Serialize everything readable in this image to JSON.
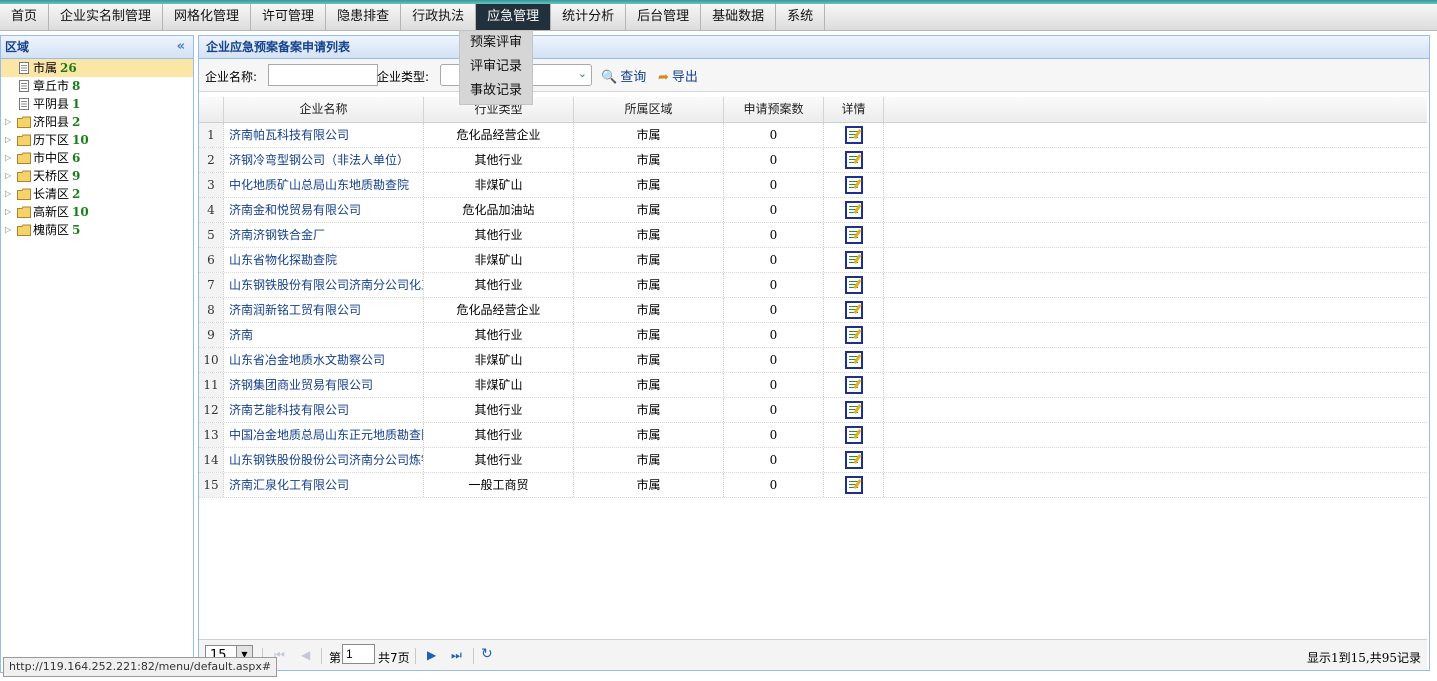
{
  "nav": {
    "items": [
      "首页",
      "企业实名制管理",
      "网格化管理",
      "许可管理",
      "隐患排查",
      "行政执法",
      "应急管理",
      "统计分析",
      "后台管理",
      "基础数据",
      "系统"
    ],
    "active_index": 6,
    "dropdown": [
      "预案评审",
      "评审记录",
      "事故记录"
    ]
  },
  "left": {
    "title": "区域",
    "collapse_icon": "double-chevron-left-icon",
    "tree": [
      {
        "label": "市属",
        "count": "26",
        "type": "leaf",
        "selected": true
      },
      {
        "label": "章丘市",
        "count": "8",
        "type": "leaf"
      },
      {
        "label": "平阴县",
        "count": "1",
        "type": "leaf"
      },
      {
        "label": "济阳县",
        "count": "2",
        "type": "folder"
      },
      {
        "label": "历下区",
        "count": "10",
        "type": "folder"
      },
      {
        "label": "市中区",
        "count": "6",
        "type": "folder"
      },
      {
        "label": "天桥区",
        "count": "9",
        "type": "folder"
      },
      {
        "label": "长清区",
        "count": "2",
        "type": "folder"
      },
      {
        "label": "高新区",
        "count": "10",
        "type": "folder"
      },
      {
        "label": "槐荫区",
        "count": "5",
        "type": "folder"
      }
    ]
  },
  "main": {
    "title": "企业应急预案备案申请列表",
    "toolbar": {
      "name_label": "企业名称:",
      "name_value": "",
      "type_label": "企业类型:",
      "type_value": "",
      "search_label": "查询",
      "export_label": "导出"
    },
    "columns": [
      "企业名称",
      "行业类型",
      "所属区域",
      "申请预案数",
      "详情"
    ],
    "rows": [
      {
        "num": "1",
        "name": "济南帕瓦科技有限公司",
        "type": "危化品经营企业",
        "area": "市属",
        "count": "0"
      },
      {
        "num": "2",
        "name": "济钢冷弯型钢公司（非法人单位）",
        "type": "其他行业",
        "area": "市属",
        "count": "0"
      },
      {
        "num": "3",
        "name": "中化地质矿山总局山东地质勘查院",
        "type": "非煤矿山",
        "area": "市属",
        "count": "0"
      },
      {
        "num": "4",
        "name": "济南金和悦贸易有限公司",
        "type": "危化品加油站",
        "area": "市属",
        "count": "0"
      },
      {
        "num": "5",
        "name": "济南济钢铁合金厂",
        "type": "其他行业",
        "area": "市属",
        "count": "0"
      },
      {
        "num": "6",
        "name": "山东省物化探勘查院",
        "type": "非煤矿山",
        "area": "市属",
        "count": "0"
      },
      {
        "num": "7",
        "name": "山东钢铁股份有限公司济南分公司化工",
        "type": "其他行业",
        "area": "市属",
        "count": "0"
      },
      {
        "num": "8",
        "name": "济南润新铭工贸有限公司",
        "type": "危化品经营企业",
        "area": "市属",
        "count": "0"
      },
      {
        "num": "9",
        "name": "济南",
        "type": "其他行业",
        "area": "市属",
        "count": "0"
      },
      {
        "num": "10",
        "name": "山东省冶金地质水文勘察公司",
        "type": "非煤矿山",
        "area": "市属",
        "count": "0"
      },
      {
        "num": "11",
        "name": "济钢集团商业贸易有限公司",
        "type": "非煤矿山",
        "area": "市属",
        "count": "0"
      },
      {
        "num": "12",
        "name": "济南艺能科技有限公司",
        "type": "其他行业",
        "area": "市属",
        "count": "0"
      },
      {
        "num": "13",
        "name": "中国冶金地质总局山东正元地质勘查院",
        "type": "其他行业",
        "area": "市属",
        "count": "0"
      },
      {
        "num": "14",
        "name": "山东钢铁股份股份公司济南分公司炼铁厂",
        "type": "其他行业",
        "area": "市属",
        "count": "0"
      },
      {
        "num": "15",
        "name": "济南汇泉化工有限公司",
        "type": "一般工商贸",
        "area": "市属",
        "count": "0"
      }
    ],
    "pager": {
      "page_size": "15",
      "page_prefix": "第",
      "page_value": "1",
      "page_suffix": "共7页",
      "record_info": "显示1到15,共95记录"
    }
  },
  "status_url": "http://119.164.252.221:82/menu/default.aspx#",
  "colors": {
    "nav_active": "#22303c",
    "panel_border": "#99bbe8",
    "link": "#14408a",
    "count_green": "#1b7c1b"
  }
}
